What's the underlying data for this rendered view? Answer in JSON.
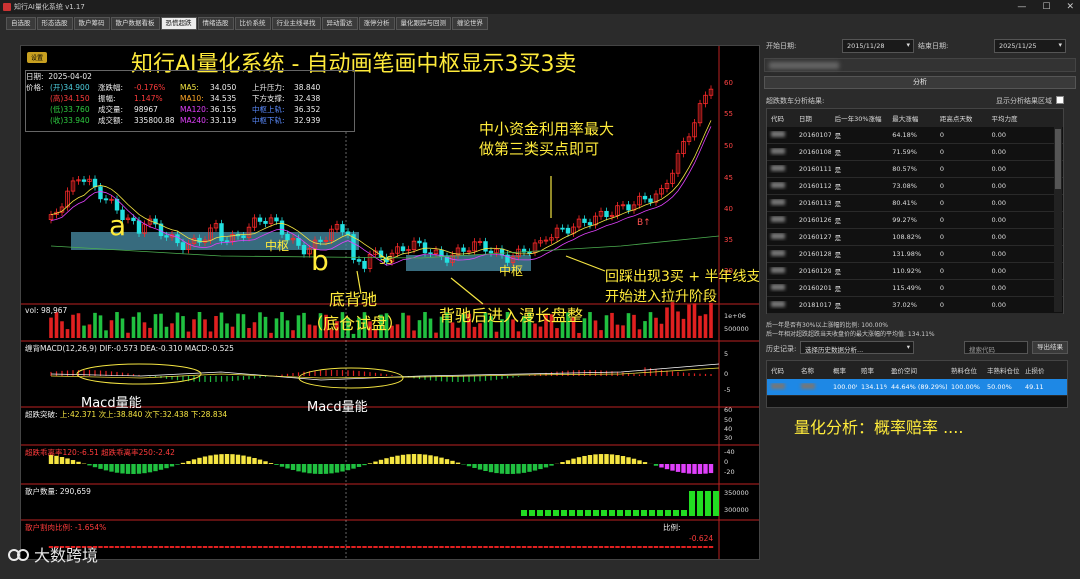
{
  "window": {
    "title": "知行AI量化系统 v1.17",
    "min": "—",
    "max": "☐",
    "close": "✕"
  },
  "tabs": [
    "自选股",
    "形态选股",
    "散户筹码",
    "散户数据看板",
    "恐慌超跌",
    "情绪选股",
    "比价系统",
    "行业主线寻找",
    "异动雷达",
    "涨停分析",
    "量化跟踪与回测",
    "缠论世界"
  ],
  "active_tab": 4,
  "chart": {
    "settings_btn": "设置",
    "headline": "知行AI量化系统 - 自动画笔画中枢显示3买3卖",
    "info": {
      "date_label": "日期:",
      "date": "2025-04-02",
      "price_label": "价格:",
      "rows": [
        {
          "a": "(开)34.900",
          "b": "涨跌幅:",
          "c": "-0.176%",
          "d": "MA5:",
          "e": "34.050",
          "f": "上升压力:",
          "g": "38.840"
        },
        {
          "a": "(高)34.150",
          "b": "振幅:",
          "c": "1.147%",
          "d": "MA10:",
          "e": "34.535",
          "f": "下方支撑:",
          "g": "32.438"
        },
        {
          "a": "(低)33.760",
          "b": "成交量:",
          "c": "98967",
          "d": "MA120:",
          "e": "36.155",
          "f": "中枢上轨:",
          "g": "36.352"
        },
        {
          "a": "(收)33.940",
          "b": "成交额:",
          "c": "335800.88",
          "d": "MA240:",
          "e": "33.119",
          "f": "中枢下轨:",
          "g": "32.939"
        }
      ]
    },
    "price_axis": [
      "60",
      "55",
      "50",
      "45",
      "40",
      "35",
      "30"
    ],
    "annotations": {
      "a": "a",
      "b": "b",
      "zhongshu1": "中枢",
      "zhongshu2": "中枢",
      "threeS": "3S",
      "bottom_div": "底背驰",
      "bottom_div2": "（底仓试盘）",
      "after_div": "背驰后进入漫长盘整",
      "capital1": "中小资金利用率最大",
      "capital2": "做第三类买点即可",
      "pullback1": "回踩出现3买 + 半年线支撑",
      "pullback2": "开始进入拉升阶段",
      "macd1": "Macd量能",
      "macd2": "Macd量能",
      "b1": "B↑"
    },
    "vol_label": "vol: 98,967",
    "vol_axis": [
      "1e+06",
      "500000"
    ],
    "macd_label": "缠背MACD(12,26,9)",
    "macd_vals": "DIF:-0.573 DEA:-0.310 MACD:-0.525",
    "macd_axis": [
      "5",
      "0",
      "-5"
    ],
    "overfall_label": "超跌突破:",
    "overfall_vals": "上:42.371  次上:38.840  次下:32.438  下:28.834",
    "overfall_axis": [
      "60",
      "50",
      "40",
      "30"
    ],
    "pos_label": "超跌乖离率120:-6.51  超跌乖离率250:-2.42",
    "pos_axis": [
      "-40",
      "0",
      "-20"
    ],
    "retail_label": "散户数量: 290,659",
    "retail_axis": [
      "350000",
      "300000"
    ],
    "retail_ratio_label": "散户割肉比例: -1.654%",
    "ratio_right": "比例:",
    "ratio_value": "-0.624"
  },
  "right": {
    "start_label": "开始日期:",
    "start_date": "2015/11/28",
    "end_label": "结束日期:",
    "end_date": "2025/11/25",
    "analyze_btn": "分析",
    "result_title": "超跌数车分析结果:",
    "show_region_label": "显示分析结果区域",
    "table1_headers": [
      "代码",
      "日期",
      "后一年30%涨幅",
      "最大涨幅",
      "距高点天数",
      "平均力度"
    ],
    "table1_rows": [
      {
        "date": "20160107",
        "flag": "是",
        "max": "64.18%",
        "days": "0",
        "avg": "0.00"
      },
      {
        "date": "20160108",
        "flag": "是",
        "max": "71.59%",
        "days": "0",
        "avg": "0.00"
      },
      {
        "date": "20160111",
        "flag": "是",
        "max": "80.57%",
        "days": "0",
        "avg": "0.00"
      },
      {
        "date": "20160112",
        "flag": "是",
        "max": "73.08%",
        "days": "0",
        "avg": "0.00"
      },
      {
        "date": "20160113",
        "flag": "是",
        "max": "80.41%",
        "days": "0",
        "avg": "0.00"
      },
      {
        "date": "20160126",
        "flag": "是",
        "max": "99.27%",
        "days": "0",
        "avg": "0.00"
      },
      {
        "date": "20160127",
        "flag": "是",
        "max": "108.82%",
        "days": "0",
        "avg": "0.00"
      },
      {
        "date": "20160128",
        "flag": "是",
        "max": "131.98%",
        "days": "0",
        "avg": "0.00"
      },
      {
        "date": "20160129",
        "flag": "是",
        "max": "110.92%",
        "days": "0",
        "avg": "0.00"
      },
      {
        "date": "20160201",
        "flag": "是",
        "max": "115.49%",
        "days": "0",
        "avg": "0.00"
      },
      {
        "date": "20181017",
        "flag": "是",
        "max": "37.02%",
        "days": "0",
        "avg": "0.00"
      }
    ],
    "stat1": "后一年是否有30%以上涨幅的比例: 100.00%",
    "stat2": "后一年相对超跌超跌当天收盘价的最大涨幅的平均值: 134.11%",
    "history_label": "历史记录:",
    "history_select": "选择历史数据分析...",
    "search_placeholder": "搜索代码",
    "export_btn": "导出结果",
    "table2_headers": [
      "代码",
      "名称",
      "概率",
      "赔率",
      "盈价空间",
      "熟料仓位",
      "丰熟料仓位",
      "止损价"
    ],
    "table2_row": {
      "prob": "100.00%",
      "odds": "134.11%",
      "space": "44.64% (89.29%)",
      "pos1": "100.00%",
      "pos2": "50.00%",
      "stop": "49.11"
    },
    "quant_note": "量化分析：概率赔率 ...."
  },
  "watermark": "大数跨境"
}
